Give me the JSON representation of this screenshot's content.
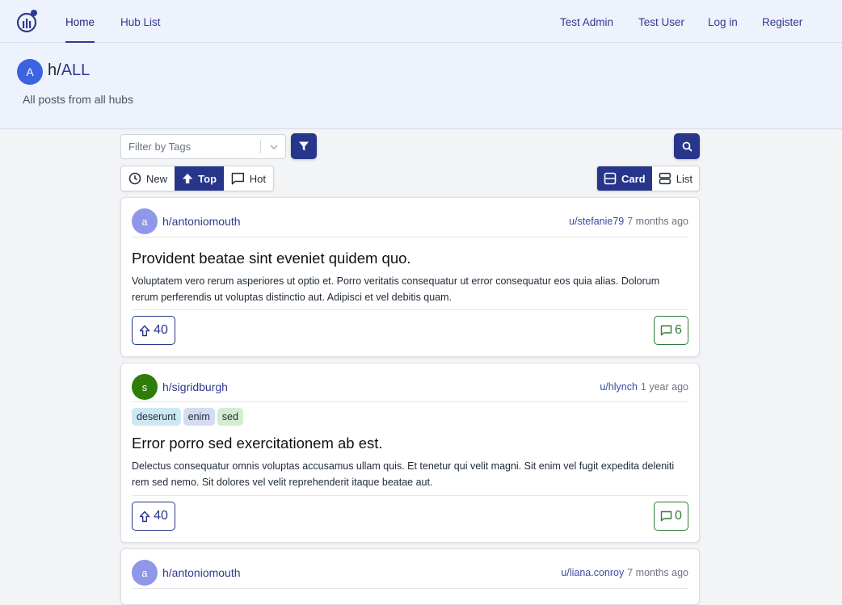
{
  "nav": {
    "home": "Home",
    "hub_list": "Hub List",
    "test_admin": "Test Admin",
    "test_user": "Test User",
    "login": "Log in",
    "register": "Register"
  },
  "hub": {
    "avatar_letter": "A",
    "prefix": "h/",
    "name": "ALL",
    "description": "All posts from all hubs"
  },
  "filters": {
    "tags_placeholder": "Filter by Tags",
    "sort_new": "New",
    "sort_top": "Top",
    "sort_hot": "Hot",
    "view_card": "Card",
    "view_list": "List"
  },
  "colors": {
    "primary": "#27358a",
    "comment": "#2e7d32"
  },
  "posts": [
    {
      "avatar_letter": "a",
      "avatar_color": "#8f97e8",
      "hub": "h/antoniomouth",
      "user": "u/stefanie79",
      "time": "7 months ago",
      "tags": [],
      "title": "Provident beatae sint eveniet quidem quo.",
      "body": "Voluptatem vero rerum asperiores ut optio et. Porro veritatis consequatur ut error consequatur eos quia alias. Dolorum rerum perferendis ut voluptas distinctio aut. Adipisci et vel debitis quam.",
      "votes": "40",
      "comments": "6"
    },
    {
      "avatar_letter": "s",
      "avatar_color": "#2e7d08",
      "hub": "h/sigridburgh",
      "user": "u/hlynch",
      "time": "1 year ago",
      "tags": [
        "deserunt",
        "enim",
        "sed"
      ],
      "title": "Error porro sed exercitationem ab est.",
      "body": "Delectus consequatur omnis voluptas accusamus ullam quis. Et tenetur qui velit magni. Sit enim vel fugit expedita deleniti rem sed nemo. Sit dolores vel velit reprehenderit itaque beatae aut.",
      "votes": "40",
      "comments": "0"
    },
    {
      "avatar_letter": "a",
      "avatar_color": "#8f97e8",
      "hub": "h/antoniomouth",
      "user": "u/liana.conroy",
      "time": "7 months ago"
    }
  ]
}
